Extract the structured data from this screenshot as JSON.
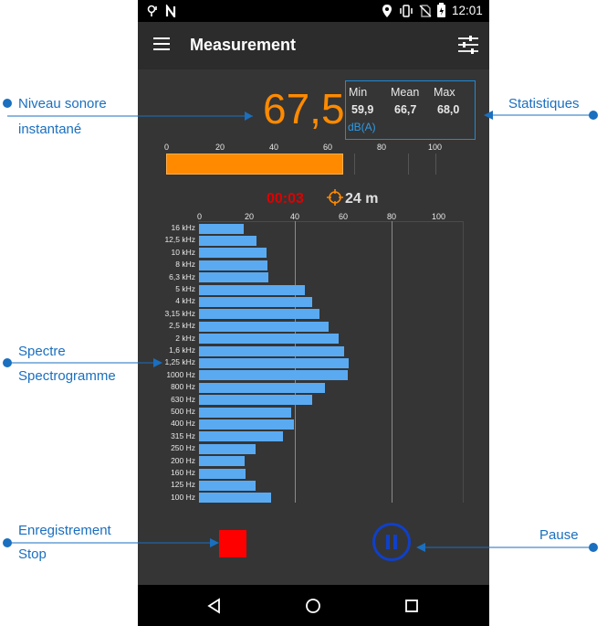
{
  "status": {
    "time": "12:01"
  },
  "appbar": {
    "title": "Measurement"
  },
  "level": {
    "value": "67,5",
    "bar_percent": 0.65
  },
  "stats": {
    "min_label": "Min",
    "mean_label": "Mean",
    "max_label": "Max",
    "min": "59,9",
    "mean": "66,7",
    "max": "68,0",
    "unit": "dB(A)"
  },
  "scale_ticks": [
    "0",
    "20",
    "40",
    "60",
    "80",
    "100"
  ],
  "timer": "00:03",
  "distance": "24 m",
  "spectrum": {
    "ticks": [
      "0",
      "20",
      "40",
      "60",
      "80",
      "100"
    ],
    "bands": [
      {
        "label": "16 kHz",
        "value": 18.5
      },
      {
        "label": "12,5 kHz",
        "value": 24
      },
      {
        "label": "10 kHz",
        "value": 28
      },
      {
        "label": "8 kHz",
        "value": 28.5
      },
      {
        "label": "6,3 kHz",
        "value": 28.8
      },
      {
        "label": "5 kHz",
        "value": 44
      },
      {
        "label": "4 kHz",
        "value": 47
      },
      {
        "label": "3,15 kHz",
        "value": 50
      },
      {
        "label": "2,5 kHz",
        "value": 54
      },
      {
        "label": "2 kHz",
        "value": 58
      },
      {
        "label": "1,6 kHz",
        "value": 60.5
      },
      {
        "label": "1,25 kHz",
        "value": 62.3
      },
      {
        "label": "1000 Hz",
        "value": 62
      },
      {
        "label": "800 Hz",
        "value": 52.5
      },
      {
        "label": "630 Hz",
        "value": 47
      },
      {
        "label": "500 Hz",
        "value": 38.5
      },
      {
        "label": "400 Hz",
        "value": 39.5
      },
      {
        "label": "315 Hz",
        "value": 35
      },
      {
        "label": "250 Hz",
        "value": 23.5
      },
      {
        "label": "200 Hz",
        "value": 19
      },
      {
        "label": "160 Hz",
        "value": 19.5
      },
      {
        "label": "125 Hz",
        "value": 23.5
      },
      {
        "label": "100 Hz",
        "value": 30
      }
    ]
  },
  "callouts": {
    "niveau_line1": "Niveau sonore",
    "niveau_line2": "instantané",
    "statistiques": "Statistiques",
    "spectre_line1": "Spectre",
    "spectre_line2": "Spectrogramme",
    "enreg_line1": "Enregistrement",
    "enreg_line2": "Stop",
    "pause": "Pause"
  },
  "colors": {
    "accent_orange": "#ff8a00",
    "stop_red": "#ff0000",
    "pause_blue": "#1040c8",
    "callout_blue": "#1a6fbf",
    "spectrum_bar": "#5aaaf2"
  }
}
